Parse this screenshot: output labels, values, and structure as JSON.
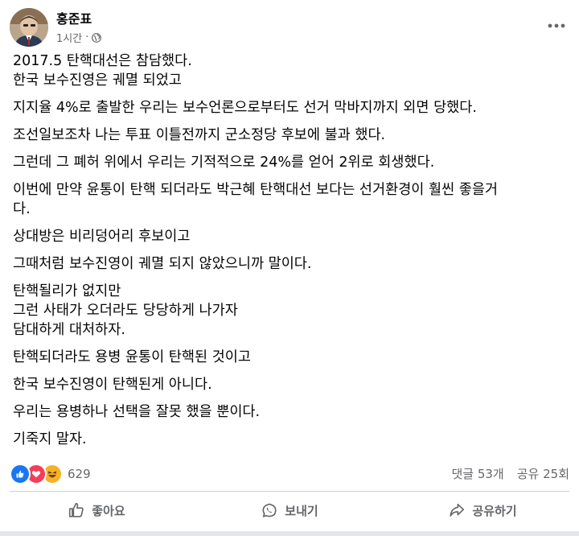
{
  "post": {
    "author": "홍준표",
    "time": "1시간",
    "separator": "·",
    "privacy_icon": "globe-icon",
    "more_icon": "more-horizontal-icon",
    "paragraphs": [
      [
        "2017.5 탄핵대선은 참담했다.",
        "한국 보수진영은 궤멸 되었고"
      ],
      [
        "지지율 4%로 출발한 우리는 보수언론으로부터도 선거 막바지까지 외면 당했다."
      ],
      [
        "조선일보조차 나는 투표 이틀전까지 군소정당 후보에 불과 했다."
      ],
      [
        "그런데 그 폐허 위에서 우리는 기적적으로 24%를 얻어 2위로 회생했다."
      ],
      [
        "이번에 만약 윤통이 탄핵 되더라도 박근혜 탄핵대선 보다는 선거환경이 훨씬 좋을거",
        "다."
      ],
      [
        "상대방은 비리덩어리 후보이고"
      ],
      [
        "그때처럼 보수진영이 궤멸 되지 않았으니까 말이다."
      ],
      [
        "탄핵될리가 없지만",
        "그런 사태가 오더라도 당당하게 나가자",
        "담대하게 대처하자."
      ],
      [
        "탄핵되더라도 용병 윤통이 탄핵된 것이고"
      ],
      [
        "한국 보수진영이 탄핵된게 아니다."
      ],
      [
        "우리는 용병하나 선택을 잘못 했을 뿐이다."
      ],
      [
        "기죽지 말자."
      ]
    ]
  },
  "reactions": {
    "icons": [
      "like-icon",
      "love-icon",
      "haha-icon"
    ],
    "count": "629",
    "comments": "댓글 53개",
    "shares": "공유 25회"
  },
  "actions": {
    "like_label": "좋아요",
    "send_label": "보내기",
    "share_label": "공유하기"
  },
  "colors": {
    "text": "#050505",
    "secondary": "#65676b",
    "like": "#1877f2",
    "love": "#f33e58",
    "haha": "#f7b125"
  }
}
